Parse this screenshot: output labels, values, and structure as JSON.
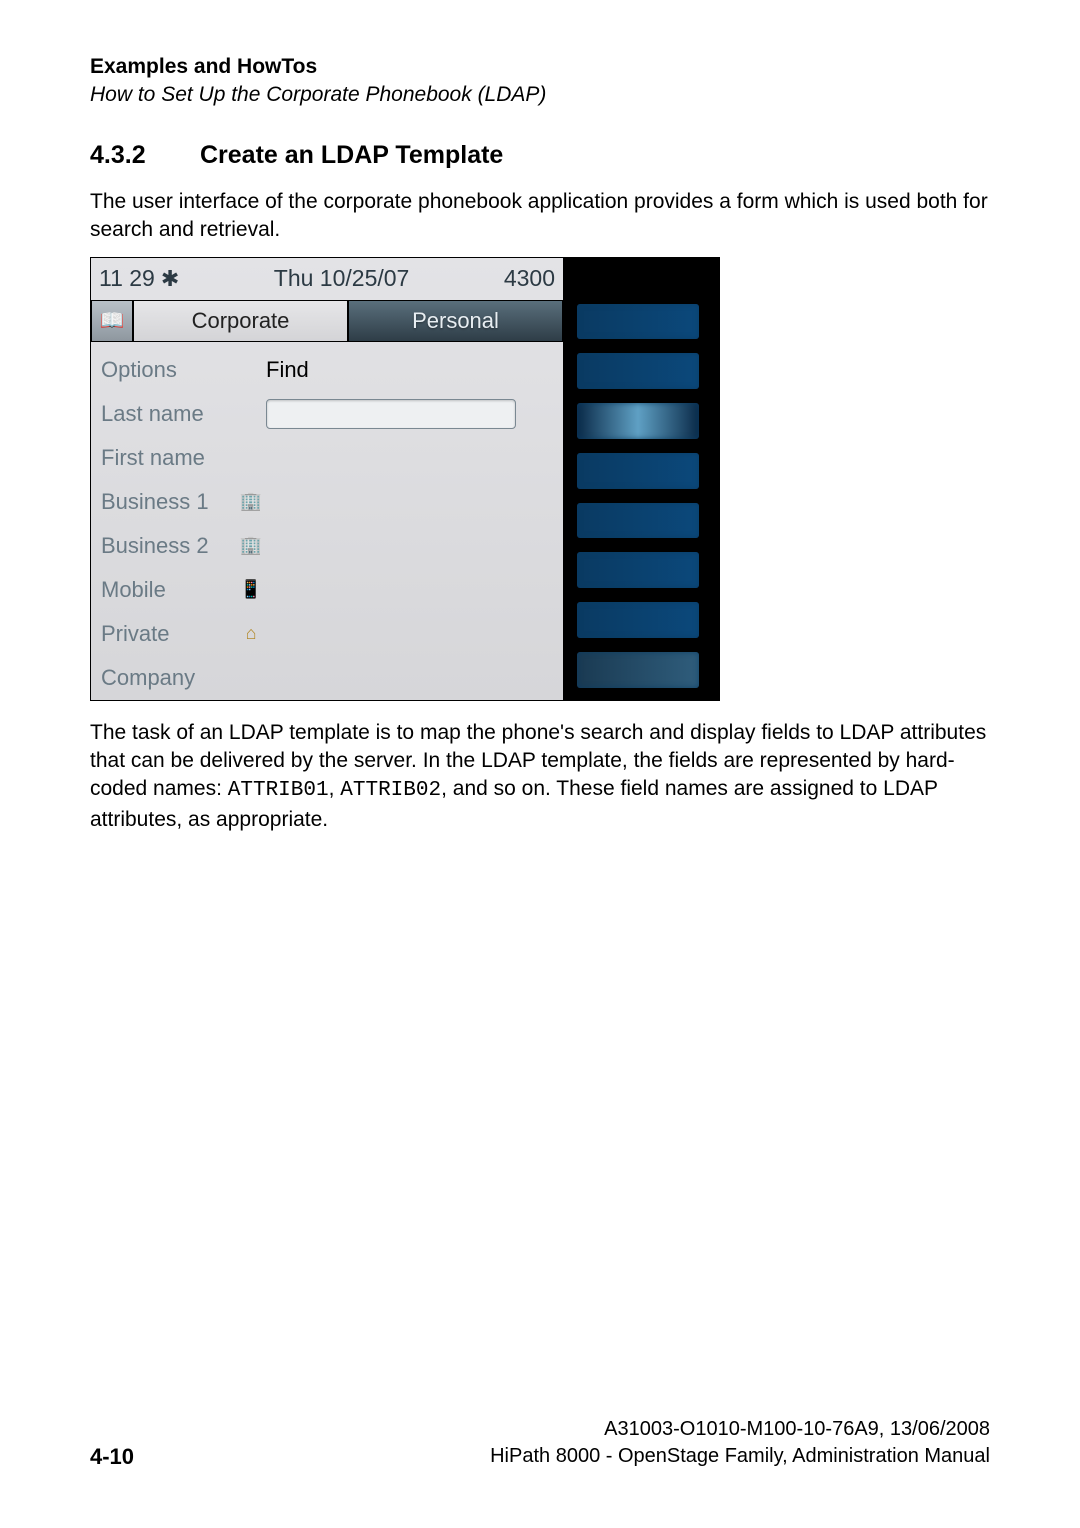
{
  "header": {
    "chapter": "Examples and HowTos",
    "section": "How to Set Up the Corporate Phonebook (LDAP)"
  },
  "subheading": {
    "number": "4.3.2",
    "title": "Create an LDAP Template"
  },
  "para1": "The user interface of the corporate phonebook application provides a form which is used both for search and retrieval.",
  "para2_a": "The task of an LDAP template is to map the phone's search and display fields to LDAP attributes that can be delivered by the server. In the LDAP template, the fields are represented by hard-coded names: ",
  "para2_code1": "ATTRIB01",
  "para2_mid": ", ",
  "para2_code2": "ATTRIB02",
  "para2_b": ", and so on. These field names are assigned to LDAP attributes, as appropriate.",
  "screen": {
    "time": "11 29",
    "date": "Thu 10/25/07",
    "ext": "4300",
    "tab_corporate": "Corporate",
    "tab_personal": "Personal",
    "options": "Options",
    "find": "Find",
    "fields": {
      "last": "Last name",
      "first": "First name",
      "b1": "Business 1",
      "b2": "Business 2",
      "mobile": "Mobile",
      "private": "Private",
      "company": "Company"
    }
  },
  "footer": {
    "page": "4-10",
    "docid": "A31003-O1010-M100-10-76A9, 13/06/2008",
    "manual": "HiPath 8000 - OpenStage Family, Administration Manual"
  }
}
